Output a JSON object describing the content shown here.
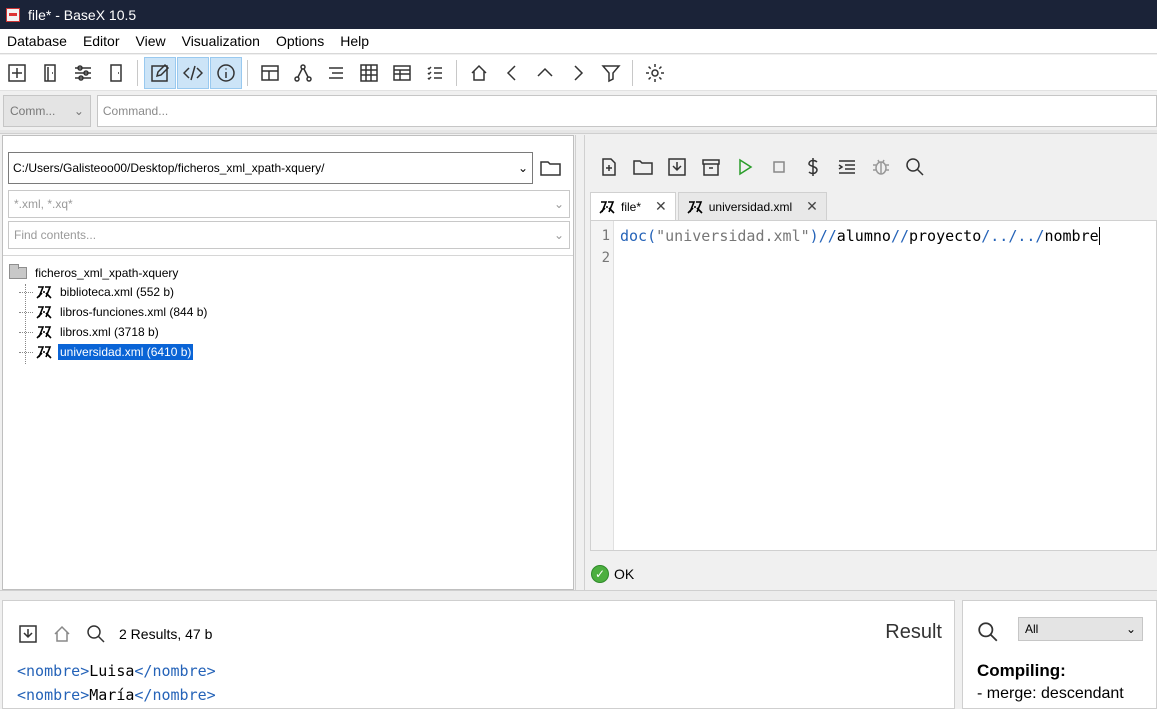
{
  "window": {
    "title": "file* - BaseX 10.5"
  },
  "menu": [
    "Database",
    "Editor",
    "View",
    "Visualization",
    "Options",
    "Help"
  ],
  "command": {
    "mode": "Comm...",
    "placeholder": "Command..."
  },
  "files": {
    "path": "C:/Users/Galisteoo00/Desktop/ficheros_xml_xpath-xquery/",
    "filter_placeholder": "*.xml, *.xq*",
    "contents_placeholder": "Find contents...",
    "root": "ficheros_xml_xpath-xquery",
    "items": [
      {
        "label": "biblioteca.xml (552 b)",
        "selected": false
      },
      {
        "label": "libros-funciones.xml (844 b)",
        "selected": false
      },
      {
        "label": "libros.xml (3718 b)",
        "selected": false
      },
      {
        "label": "universidad.xml (6410 b)",
        "selected": true
      }
    ]
  },
  "editor": {
    "tabs": [
      {
        "label": "file*",
        "active": true
      },
      {
        "label": "universidad.xml",
        "active": false
      }
    ],
    "lines": [
      {
        "number": "1",
        "parts": {
          "fn": "doc",
          "open": "(",
          "str": "\"universidad.xml\"",
          "close": ")",
          "s1": "//",
          "a": "alumno",
          "s2": "//",
          "p": "proyecto",
          "s3": "/../../",
          "n": "nombre"
        }
      },
      {
        "number": "2"
      }
    ],
    "status": "OK"
  },
  "result": {
    "summary": "2 Results, 47 b",
    "title": "Result",
    "items": [
      {
        "open": "<nombre>",
        "value": "Luisa",
        "close": "</nombre>"
      },
      {
        "open": "<nombre>",
        "value": "María",
        "close": "</nombre>"
      }
    ]
  },
  "info": {
    "filter": "All",
    "heading": "Compiling:",
    "text": "- merge: descendant"
  }
}
